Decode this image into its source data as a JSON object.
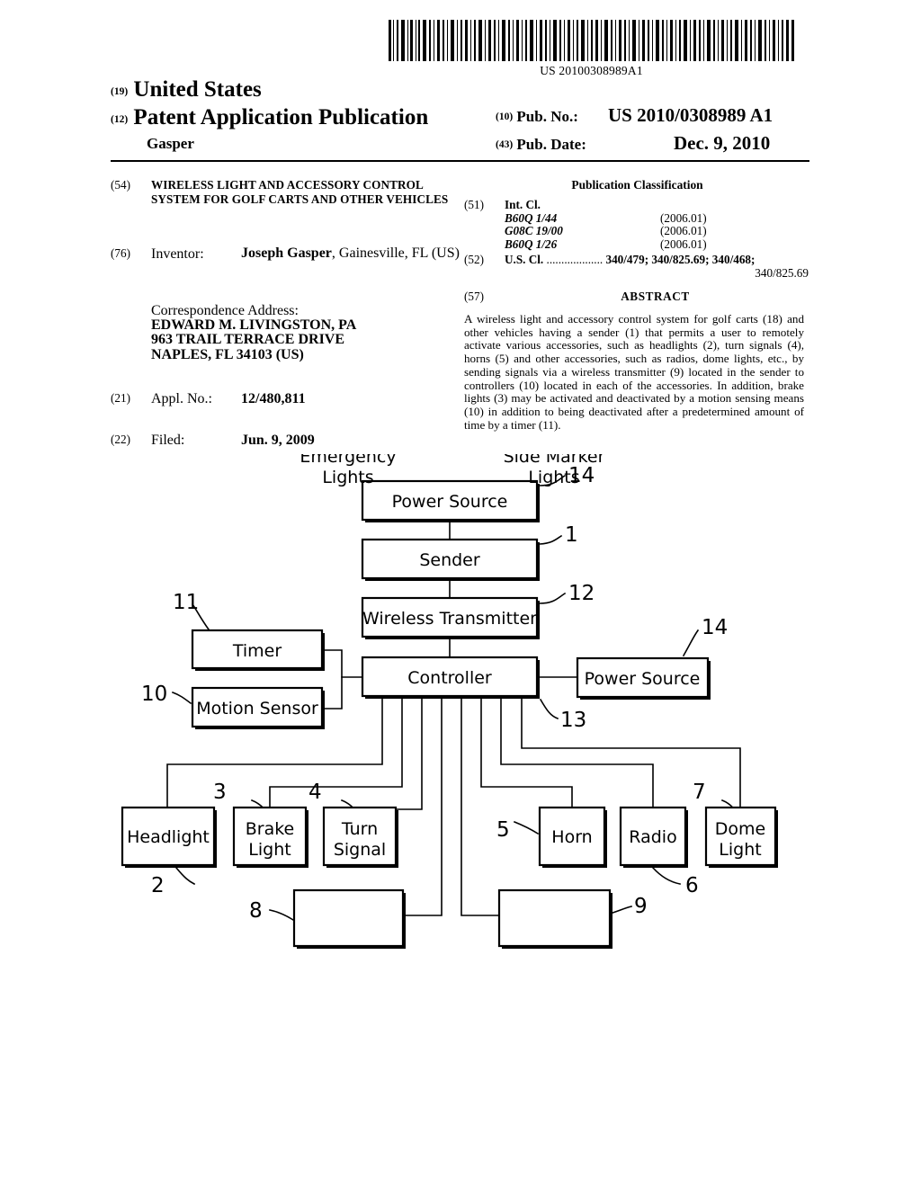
{
  "barcode": {
    "number": "US 20100308989A1",
    "icon": "barcode-icon"
  },
  "header": {
    "kind_code_19": "(19)",
    "country": "United States",
    "kind_code_12": "(12)",
    "doc_type": "Patent Application Publication",
    "inventor_surname": "Gasper",
    "pub_no_code": "(10)",
    "pub_no_label": "Pub. No.:",
    "pub_no_value": "US 2010/0308989 A1",
    "pub_date_code": "(43)",
    "pub_date_label": "Pub. Date:",
    "pub_date_value": "Dec. 9, 2010"
  },
  "biblio": {
    "title_code": "(54)",
    "title": "WIRELESS LIGHT AND ACCESSORY CONTROL SYSTEM FOR GOLF CARTS AND OTHER VEHICLES",
    "inventor_code": "(76)",
    "inventor_label": "Inventor:",
    "inventor_name": "Joseph Gasper",
    "inventor_rest": ", Gainesville, FL (US)",
    "correspondence_label": "Correspondence Address:",
    "correspondence_lines": [
      "EDWARD M. LIVINGSTON, PA",
      "963 TRAIL TERRACE DRIVE",
      "NAPLES, FL 34103 (US)"
    ],
    "appl_code": "(21)",
    "appl_label": "Appl. No.:",
    "appl_value": "12/480,811",
    "filed_code": "(22)",
    "filed_label": "Filed:",
    "filed_value": "Jun. 9, 2009"
  },
  "classification": {
    "heading": "Publication Classification",
    "int_cl_code": "(51)",
    "int_cl_label": "Int. Cl.",
    "int_cl_rows": [
      {
        "code": "B60Q  1/44",
        "year": "(2006.01)"
      },
      {
        "code": "G08C 19/00",
        "year": "(2006.01)"
      },
      {
        "code": "B60Q  1/26",
        "year": "(2006.01)"
      }
    ],
    "us_cl_code": "(52)",
    "us_cl_label": "U.S. Cl.",
    "us_cl_dots": " ...................  ",
    "us_cl_line1": "340/479; 340/825.69; 340/468;",
    "us_cl_line2": "340/825.69"
  },
  "abstract": {
    "code": "(57)",
    "heading": "ABSTRACT",
    "text": "A wireless light and accessory control system for golf carts (18) and other vehicles having a sender (1) that permits a user to remotely activate various accessories, such as headlights (2), turn signals (4), horns (5) and other accessories, such as radios, dome lights, etc., by sending signals via a wireless transmitter (9) located in the sender to controllers (10) located in each of the accessories. In addition, brake lights (3) may be activated and deactivated by a motion sensing means (10) in addition to being deactivated after a predetermined amount of time by a timer (11)."
  },
  "figure": {
    "blocks": {
      "power_source_top": "Power Source",
      "sender": "Sender",
      "wireless_transmitter": "Wireless Transmitter",
      "timer": "Timer",
      "motion_sensor": "Motion Sensor",
      "controller": "Controller",
      "power_source_right": "Power Source",
      "headlight": "Headlight",
      "brake_light_1": "Brake",
      "brake_light_2": "Light",
      "turn_signal_1": "Turn",
      "turn_signal_2": "Signal",
      "horn": "Horn",
      "radio": "Radio",
      "dome_light_1": "Dome",
      "dome_light_2": "Light",
      "emergency_lights_1": "Emergency",
      "emergency_lights_2": "Lights",
      "side_marker_1": "Side Marker",
      "side_marker_2": "Lights"
    },
    "reference_numerals": {
      "n14_top": "14",
      "n1": "1",
      "n12": "12",
      "n11": "11",
      "n10": "10",
      "n14_right": "14",
      "n13": "13",
      "n2": "2",
      "n3": "3",
      "n4": "4",
      "n5": "5",
      "n6": "6",
      "n7": "7",
      "n8": "8",
      "n9": "9"
    }
  },
  "colors": {
    "ink": "#000000",
    "paper": "#ffffff"
  }
}
